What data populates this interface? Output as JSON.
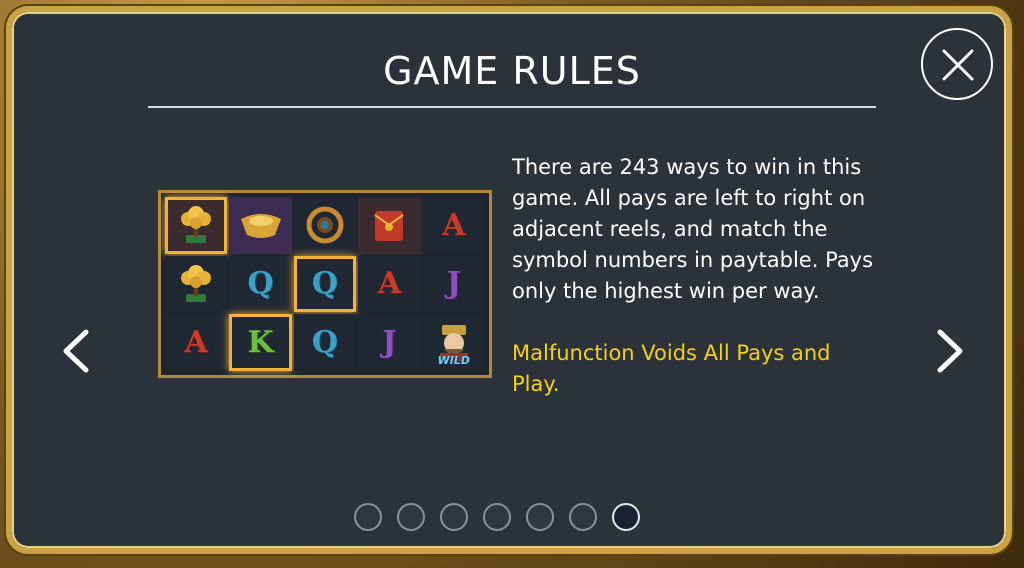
{
  "dialog": {
    "title": "GAME RULES",
    "close_icon": "close-x-icon",
    "prev_icon": "chevron-left-icon",
    "next_icon": "chevron-right-icon"
  },
  "rules": {
    "body": "There are 243 ways to win in this game. All pays are left to right on adjacent reels, and match the symbol numbers in paytable. Pays only the highest win per way.",
    "notice": "Malfunction Voids All Pays and Play."
  },
  "reel_image": {
    "rows": [
      [
        {
          "symbol": "money-tree-icon",
          "highlight": true
        },
        {
          "symbol": "gold-ingot-icon",
          "highlight": false
        },
        {
          "symbol": "drum-icon",
          "highlight": false
        },
        {
          "symbol": "red-envelope-icon",
          "highlight": false
        },
        {
          "symbol": "A",
          "highlight": false
        }
      ],
      [
        {
          "symbol": "money-tree-icon",
          "highlight": false
        },
        {
          "symbol": "Q",
          "highlight": false
        },
        {
          "symbol": "Q",
          "highlight": true
        },
        {
          "symbol": "A",
          "highlight": false
        },
        {
          "symbol": "J",
          "highlight": false
        }
      ],
      [
        {
          "symbol": "A",
          "highlight": false
        },
        {
          "symbol": "K",
          "highlight": true
        },
        {
          "symbol": "Q",
          "highlight": false
        },
        {
          "symbol": "J",
          "highlight": false
        },
        {
          "symbol": "wild-god-icon",
          "highlight": false,
          "label": "WILD"
        }
      ]
    ]
  },
  "pagination": {
    "total": 7,
    "active_index": 6
  },
  "colors": {
    "panel_bg": "#2b3239",
    "frame_gold": "#c9a445",
    "notice_yellow": "#f4d11b",
    "text_white": "#ffffff"
  }
}
